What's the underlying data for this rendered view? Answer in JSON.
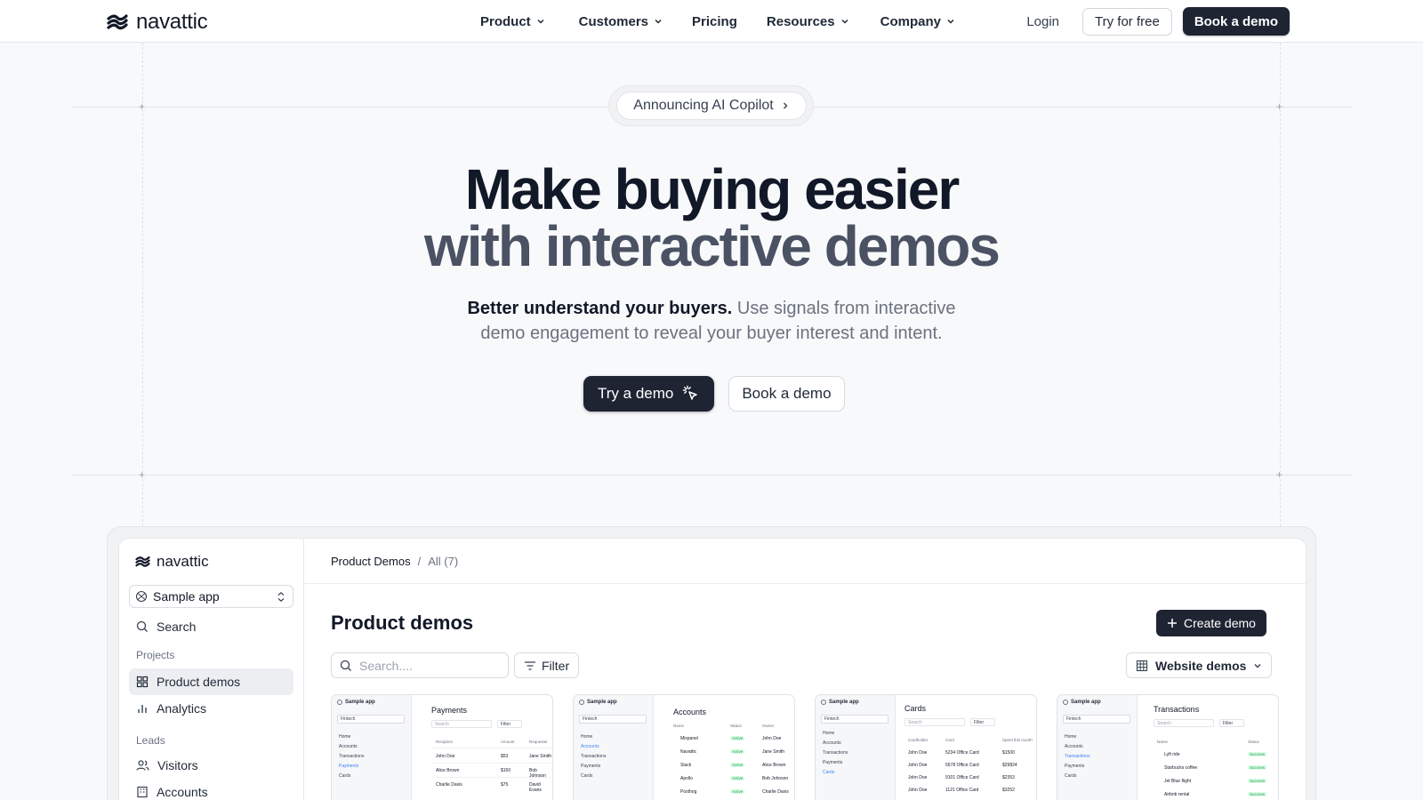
{
  "header": {
    "brand": "navattic",
    "nav": [
      {
        "label": "Product",
        "has_menu": true
      },
      {
        "label": "Customers",
        "has_menu": true
      },
      {
        "label": "Pricing",
        "has_menu": false
      },
      {
        "label": "Resources",
        "has_menu": true
      },
      {
        "label": "Company",
        "has_menu": true
      }
    ],
    "login": "Login",
    "try_free": "Try for free",
    "book_demo": "Book a demo"
  },
  "hero": {
    "announcement": "Announcing AI Copilot",
    "headline_1": "Make buying easier",
    "headline_2": "with interactive demos",
    "sub_bold": "Better understand your buyers.",
    "sub_rest_1": " Use signals from interactive",
    "sub_line_2": "demo engagement to reveal your buyer interest and intent.",
    "cta_try": "Try a demo",
    "cta_book": "Book a demo"
  },
  "app": {
    "brand": "navattic",
    "workspace": "Sample app",
    "search": "Search",
    "projects_label": "Projects",
    "product_demos": "Product demos",
    "analytics": "Analytics",
    "leads_label": "Leads",
    "visitors": "Visitors",
    "accounts": "Accounts",
    "crumb_root": "Product Demos",
    "crumb_sep": "/",
    "crumb_current": "All (7)",
    "title": "Product demos",
    "create": "Create demo",
    "search_placeholder": "Search....",
    "filter": "Filter",
    "view": "Website demos",
    "cards": [
      {
        "app": "Sample app",
        "select": "Fintech",
        "nav": [
          "Home",
          "Accounts",
          "Transactions",
          "Payments",
          "Cards"
        ],
        "active": 3,
        "title": "Payments",
        "search": "Search",
        "filter": "Filter",
        "headers": [
          "Recipient",
          "Amount",
          "Requester"
        ],
        "rows": [
          [
            "John Doe",
            "$53",
            "Jane Smith"
          ],
          [
            "Alice Brown",
            "$150",
            "Bob Johnson"
          ],
          [
            "Charlie Davis",
            "$75",
            "David Evans"
          ]
        ]
      },
      {
        "app": "Sample app",
        "select": "Fintech",
        "nav": [
          "Home",
          "Accounts",
          "Transactions",
          "Payments",
          "Cards"
        ],
        "active": 1,
        "title": "Accounts",
        "search": "",
        "filter": "",
        "headers": [
          "Name",
          "Status",
          "Owner"
        ],
        "rows": [
          [
            "Mixpanel",
            "Active",
            "John Doe"
          ],
          [
            "Navattic",
            "Active",
            "Jane Smith"
          ],
          [
            "Slack",
            "Active",
            "Alice Brown"
          ],
          [
            "Apollo",
            "Active",
            "Bob Johnson"
          ],
          [
            "Posthog",
            "Active",
            "Charlie Davis"
          ]
        ]
      },
      {
        "app": "Sample app",
        "select": "Fintech",
        "nav": [
          "Home",
          "Accounts",
          "Transactions",
          "Payments",
          "Cards"
        ],
        "active": 4,
        "title": "Cards",
        "search": "Search",
        "filter": "Filter",
        "headers": [
          "Cardholder",
          "Card",
          "Spent this month"
        ],
        "rows": [
          [
            "John Doe",
            "5234 Office Card",
            "$1500"
          ],
          [
            "John Doe",
            "5678 Office Card",
            "$29824"
          ],
          [
            "John Doe",
            "9101 Office Card",
            "$2353"
          ],
          [
            "John Doe",
            "1121 Office Card",
            "$3252"
          ]
        ]
      },
      {
        "app": "Sample app",
        "select": "Fintech",
        "nav": [
          "Home",
          "Accounts",
          "Transactions",
          "Payments",
          "Cards"
        ],
        "active": 2,
        "title": "Transactions",
        "search": "Search",
        "filter": "Filter",
        "headers": [
          "Name",
          "Status"
        ],
        "rows": [
          [
            "Lyft ride",
            "Success"
          ],
          [
            "Starbucks coffee",
            "Success"
          ],
          [
            "Jet Blue flight",
            "Success"
          ],
          [
            "Airbnb rental",
            "Success"
          ]
        ]
      }
    ]
  },
  "colors": {
    "dark": "#1f2433",
    "headline_gray": "#4a5263",
    "muted": "#6b7280",
    "success": "#16a34a"
  }
}
